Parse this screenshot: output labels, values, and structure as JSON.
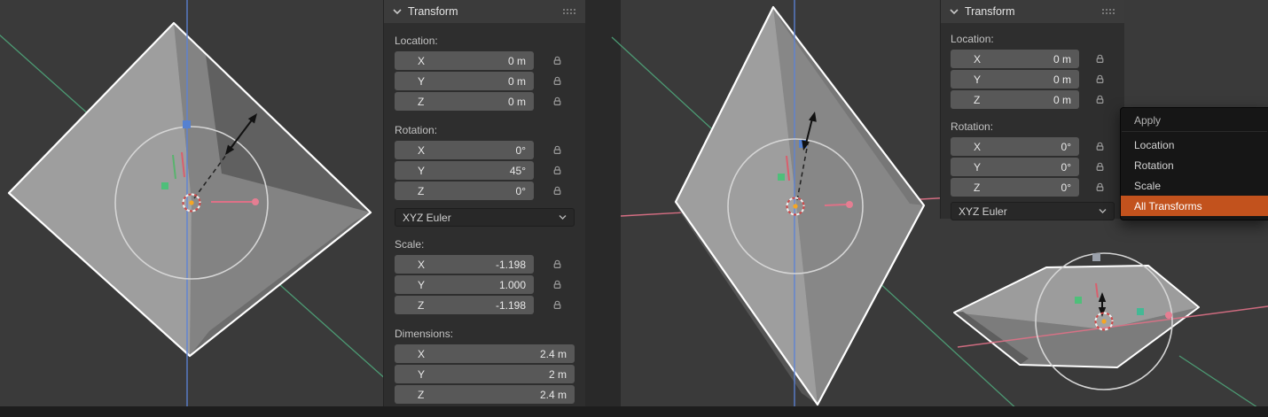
{
  "colors": {
    "accent": "#c2521d",
    "viewport_bg": "#3a3a3a",
    "gap_bg": "#282828",
    "panel_bg": "#2e2e2e",
    "panel_header_bg": "#3b3b3b",
    "field_bg": "#585858",
    "field_text": "#e8e8e8",
    "label_text": "#c3c3c3",
    "dropdown_bg": "#282828",
    "menu_bg": "#161616",
    "menu_text": "#d4d4d4",
    "bottom_bar_bg": "#1d1d1d",
    "axis_x": "#df7187",
    "axis_y": "#4ea57a",
    "axis_z": "#5b82d8",
    "gizmo_circle": "#d5d5d5",
    "object_outline": "#ffffff"
  },
  "icons": {
    "panel_collapse": "chevron-down",
    "panel_grip": "grip-dots",
    "field_lock": "padlock",
    "dropdown_arrow": "chevron-down"
  },
  "left_panel": {
    "title": "Transform",
    "location": {
      "label": "Location:",
      "rows": [
        {
          "axis": "X",
          "value": "0 m"
        },
        {
          "axis": "Y",
          "value": "0 m"
        },
        {
          "axis": "Z",
          "value": "0 m"
        }
      ]
    },
    "rotation": {
      "label": "Rotation:",
      "mode": "XYZ Euler",
      "rows": [
        {
          "axis": "X",
          "value": "0°"
        },
        {
          "axis": "Y",
          "value": "45°"
        },
        {
          "axis": "Z",
          "value": "0°"
        }
      ]
    },
    "scale": {
      "label": "Scale:",
      "rows": [
        {
          "axis": "X",
          "value": "-1.198"
        },
        {
          "axis": "Y",
          "value": "1.000"
        },
        {
          "axis": "Z",
          "value": "-1.198"
        }
      ]
    },
    "dimensions": {
      "label": "Dimensions:",
      "rows": [
        {
          "axis": "X",
          "value": "2.4 m"
        },
        {
          "axis": "Y",
          "value": "2 m"
        },
        {
          "axis": "Z",
          "value": "2.4 m"
        }
      ]
    }
  },
  "right_panel": {
    "title": "Transform",
    "location": {
      "label": "Location:",
      "rows": [
        {
          "axis": "X",
          "value": "0 m"
        },
        {
          "axis": "Y",
          "value": "0 m"
        },
        {
          "axis": "Z",
          "value": "0 m"
        }
      ]
    },
    "rotation": {
      "label": "Rotation:",
      "mode": "XYZ Euler",
      "rows": [
        {
          "axis": "X",
          "value": "0°"
        },
        {
          "axis": "Y",
          "value": "0°"
        },
        {
          "axis": "Z",
          "value": "0°"
        }
      ]
    }
  },
  "apply_menu": {
    "title": "Apply",
    "items": [
      {
        "label": "Location",
        "highlighted": false
      },
      {
        "label": "Rotation",
        "highlighted": false
      },
      {
        "label": "Scale",
        "highlighted": false
      },
      {
        "label": "All Transforms",
        "highlighted": true
      }
    ]
  }
}
